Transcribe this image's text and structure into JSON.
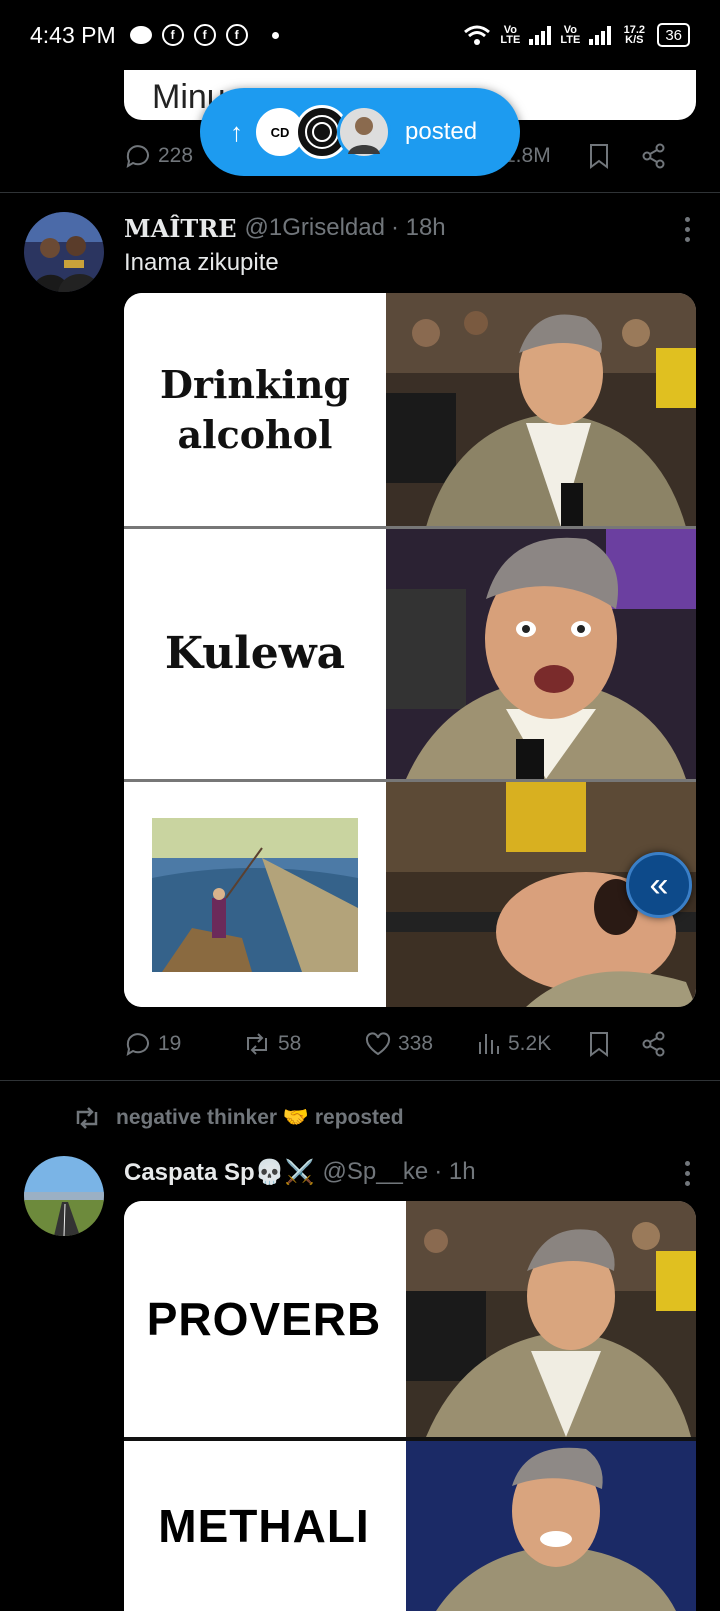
{
  "status_bar": {
    "time": "4:43 PM",
    "net1": "Vo LTE",
    "net2": "Vo LTE",
    "speed": "17.2 K/S",
    "battery": "36"
  },
  "previous_post": {
    "media_text": "Minu",
    "replies": "228",
    "views": "1.8M"
  },
  "posted_pill": {
    "label": "posted",
    "avatar_text": "CD"
  },
  "posts": [
    {
      "display_name": "MAÎTRE",
      "handle": "@1Griseldad",
      "time": "· 18h",
      "text": "Inama zikupite",
      "captions": [
        "Drinking alcohol",
        "Kulewa",
        ""
      ],
      "stats": {
        "replies": "19",
        "reposts": "58",
        "likes": "338",
        "views": "5.2K"
      }
    },
    {
      "repost_by": "negative thinker 🤝 reposted",
      "display_name": "Caspata Sp💀⚔️",
      "handle": "@Sp__ke",
      "time": "· 1h",
      "captions": [
        "PROVERB",
        "METHALI"
      ]
    }
  ],
  "colors": {
    "accent": "#1d9bf0",
    "muted": "#71767b",
    "background": "#000000"
  }
}
